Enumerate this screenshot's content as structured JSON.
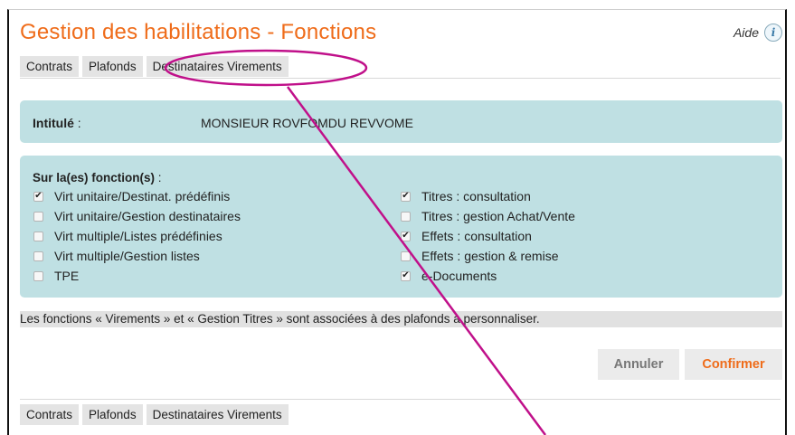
{
  "header": {
    "title": "Gestion des habilitations - Fonctions",
    "help_label": "Aide",
    "help_icon": "info-icon"
  },
  "tabs_top": [
    "Contrats",
    "Plafonds",
    "Destinataires Virements"
  ],
  "intitule": {
    "label": "Intitulé",
    "separator": " :",
    "value": "MONSIEUR ROVFOMDU REVVOME"
  },
  "functions": {
    "title": "Sur la(es) fonction(s)",
    "title_sep": "  :",
    "left": [
      {
        "label": "Virt unitaire/Destinat. prédéfinis",
        "checked": true
      },
      {
        "label": "Virt unitaire/Gestion destinataires",
        "checked": false
      },
      {
        "label": "Virt multiple/Listes prédéfinies",
        "checked": false
      },
      {
        "label": "Virt multiple/Gestion listes",
        "checked": false
      },
      {
        "label": "TPE",
        "checked": false
      }
    ],
    "right": [
      {
        "label": "Titres : consultation",
        "checked": true
      },
      {
        "label": "Titres : gestion Achat/Vente",
        "checked": false
      },
      {
        "label": "Effets : consultation",
        "checked": true
      },
      {
        "label": "Effets : gestion & remise",
        "checked": false
      },
      {
        "label": "e-Documents",
        "checked": true
      }
    ]
  },
  "notice": "Les fonctions « Virements » et « Gestion Titres » sont associées à des plafonds à personnaliser.",
  "buttons": {
    "cancel": "Annuler",
    "confirm": "Confirmer"
  },
  "tabs_bottom": [
    "Contrats",
    "Plafonds",
    "Destinataires Virements"
  ],
  "colors": {
    "accent": "#ef6c1a",
    "panel": "#bfe0e3",
    "annotation": "#c0108a"
  }
}
